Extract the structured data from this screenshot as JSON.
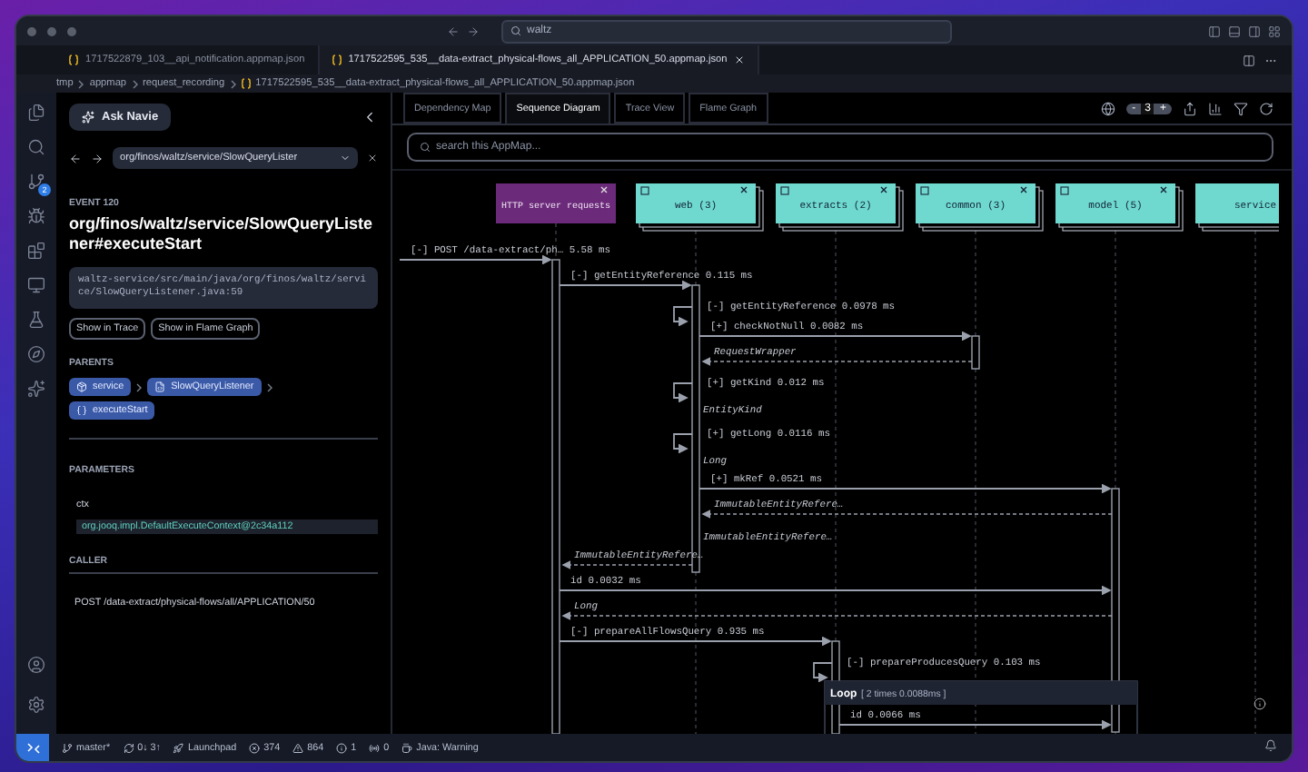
{
  "title_bar": {
    "search": "waltz"
  },
  "editor_tabs": [
    {
      "label": "1717522879_103__api_notification.appmap.json",
      "selected": false
    },
    {
      "label": "1717522595_535__data-extract_physical-flows_all_APPLICATION_50.appmap.json",
      "selected": true
    }
  ],
  "breadcrumb": [
    "tmp",
    "appmap",
    "request_recording",
    "1717522595_535__data-extract_physical-flows_all_APPLICATION_50.appmap.json"
  ],
  "activity_bar": {
    "scm_badge": "2"
  },
  "sidebar": {
    "ask_button": "Ask Navie",
    "nav_path": "org/finos/waltz/service/SlowQueryLister",
    "event_label": "EVENT 120",
    "event_title": "org/finos/waltz/service/SlowQueryListener#executeStart",
    "source_path": "waltz-service/src/main/java/org/finos/waltz/service/SlowQueryListener.java:59",
    "actions": [
      "Show in Trace",
      "Show in Flame Graph"
    ],
    "parents_heading": "PARENTS",
    "parents": [
      {
        "label": "service",
        "kind": "package"
      },
      {
        "label": "SlowQueryListener",
        "kind": "class"
      },
      {
        "label": "executeStart",
        "kind": "function"
      }
    ],
    "parameters_heading": "PARAMETERS",
    "parameters": [
      {
        "name": "ctx",
        "value": "org.jooq.impl.DefaultExecuteContext@2c34a112"
      }
    ],
    "caller_heading": "CALLER",
    "caller": "POST /data-extract/physical-flows/all/APPLICATION/50"
  },
  "view_tabs": [
    {
      "label": "Dependency Map",
      "selected": false
    },
    {
      "label": "Sequence Diagram",
      "selected": true
    },
    {
      "label": "Trace View",
      "selected": false
    },
    {
      "label": "Flame Graph",
      "selected": false
    }
  ],
  "depth_control": {
    "decrease": "-",
    "value": "3",
    "increase": "+"
  },
  "diagram": {
    "search_placeholder": "search this AppMap...",
    "lanes": [
      {
        "label": "HTTP server requests",
        "kind": "http"
      },
      {
        "label": "web (3)",
        "kind": "package"
      },
      {
        "label": "extracts (2)",
        "kind": "package"
      },
      {
        "label": "common (3)",
        "kind": "package"
      },
      {
        "label": "model (5)",
        "kind": "package"
      },
      {
        "label": "service",
        "kind": "package"
      }
    ],
    "messages": [
      {
        "kind": "call",
        "label": "[-] POST /data-extract/ph… 5.58 ms"
      },
      {
        "kind": "call",
        "label": "[-] getEntityReference 0.115 ms"
      },
      {
        "kind": "self",
        "label": "[-] getEntityReference 0.0978 ms"
      },
      {
        "kind": "call",
        "label": "[+] checkNotNull 0.0082 ms"
      },
      {
        "kind": "return",
        "label": "RequestWrapper"
      },
      {
        "kind": "self",
        "label": "[+] getKind 0.012 ms"
      },
      {
        "kind": "self_return",
        "label": "EntityKind"
      },
      {
        "kind": "self",
        "label": "[+] getLong 0.0116 ms"
      },
      {
        "kind": "self_return",
        "label": "Long"
      },
      {
        "kind": "call",
        "label": "[+] mkRef 0.0521 ms"
      },
      {
        "kind": "return",
        "label": "ImmutableEntityRefere…"
      },
      {
        "kind": "self_return",
        "label": "ImmutableEntityRefere…"
      },
      {
        "kind": "return",
        "label": "ImmutableEntityRefere…"
      },
      {
        "kind": "call",
        "label": "id 0.0032 ms"
      },
      {
        "kind": "return",
        "label": "Long"
      },
      {
        "kind": "call",
        "label": "[-] prepareAllFlowsQuery 0.935 ms"
      },
      {
        "kind": "self",
        "label": "[-] prepareProducesQuery 0.103 ms"
      }
    ],
    "loop": {
      "label": "Loop",
      "detail": "[ 2 times 0.0088ms ]",
      "messages": [
        {
          "kind": "call",
          "label": "id 0.0066 ms"
        }
      ]
    }
  },
  "status_bar": [
    {
      "kind": "branch",
      "text": "master*"
    },
    {
      "kind": "sync",
      "text": "0↓ 3↑"
    },
    {
      "kind": "launchpad",
      "text": "Launchpad"
    },
    {
      "kind": "errors",
      "text": "374"
    },
    {
      "kind": "warnings",
      "text": "864"
    },
    {
      "kind": "info",
      "text": "1"
    },
    {
      "kind": "ports",
      "text": "0"
    },
    {
      "kind": "java",
      "text": "Java: Warning"
    }
  ]
}
